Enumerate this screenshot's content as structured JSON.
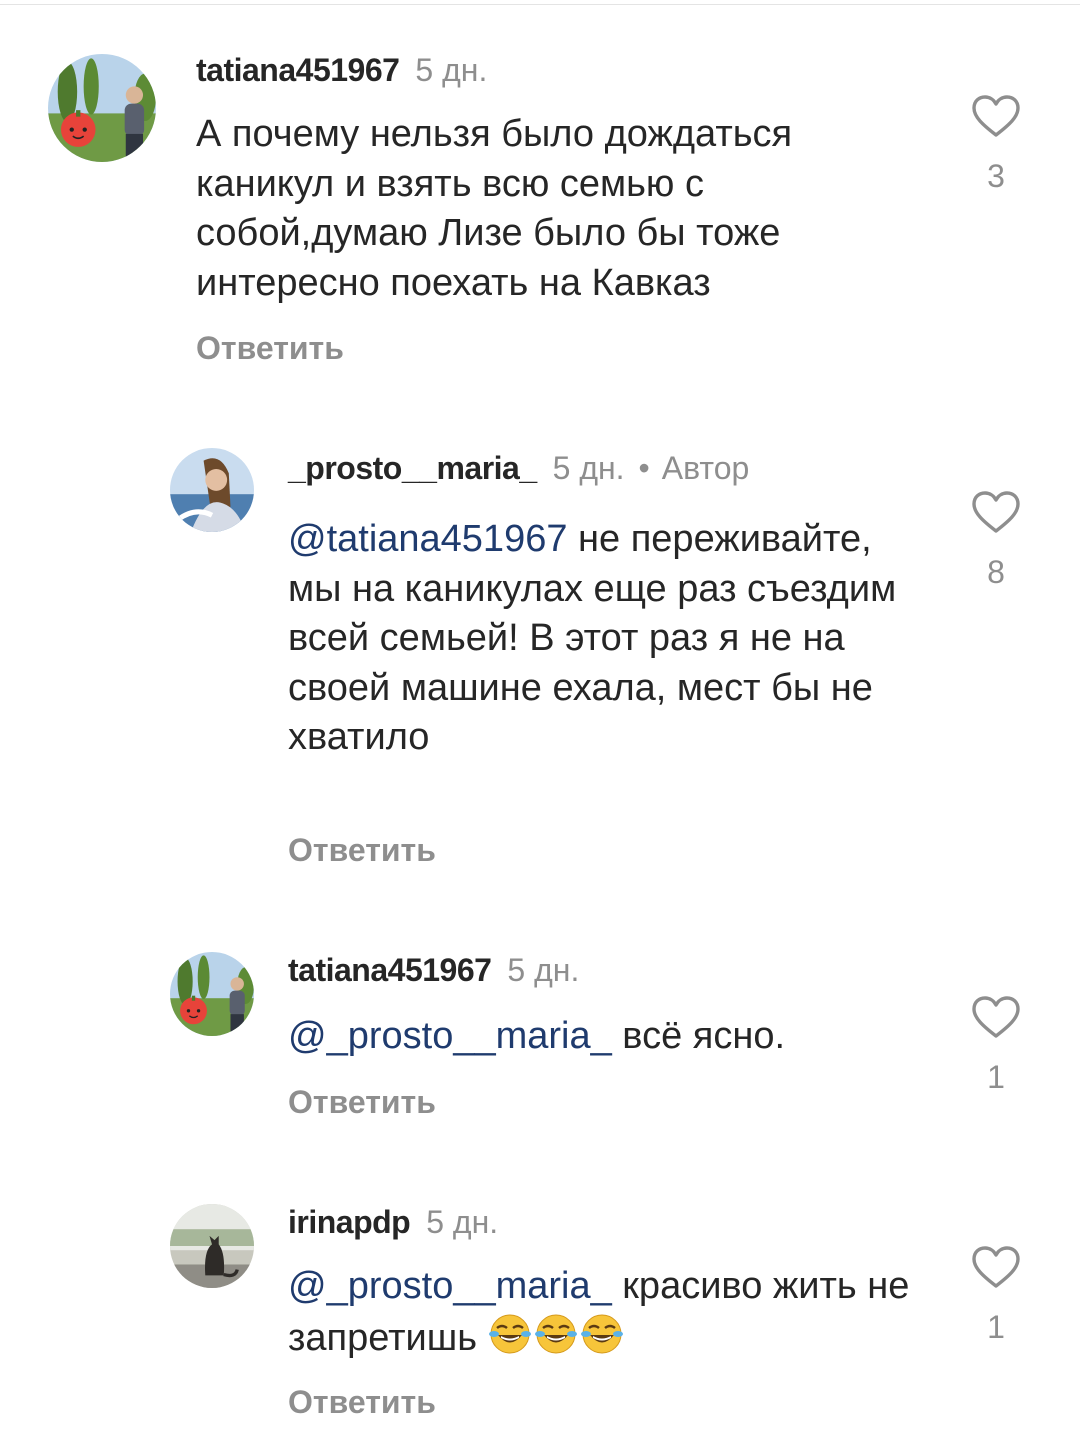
{
  "comments": [
    {
      "username": "tatiana451967",
      "time": "5 дн.",
      "text": "А почему нельзя было дождаться каникул и взять всю семью с собой,думаю Лизе было бы тоже интересно поехать на Кавказ",
      "reply_label": "Ответить",
      "likes": "3"
    },
    {
      "username": "_prosto__maria_",
      "time": "5 дн.",
      "separator": "•",
      "author_badge": "Автор",
      "mention": "@tatiana451967",
      "text": " не переживайте, мы на каникулах еще раз съездим всей семьей! В этот раз я не на своей машине ехала, мест бы не хватило",
      "reply_label": "Ответить",
      "likes": "8"
    },
    {
      "username": "tatiana451967",
      "time": "5 дн.",
      "mention": "@_prosto__maria_",
      "text": " всё ясно.",
      "reply_label": "Ответить",
      "likes": "1"
    },
    {
      "username": "irinapdp",
      "time": "5 дн.",
      "mention": "@_prosto__maria_",
      "text": " красиво жить не запретишь ",
      "emojis": [
        "face-with-tears-of-joy",
        "face-with-tears-of-joy",
        "face-with-tears-of-joy"
      ],
      "reply_label": "Ответить",
      "likes": "1"
    }
  ],
  "colors": {
    "text": "#262626",
    "secondary": "#8e8e8e",
    "mention": "#1f3b6e",
    "background": "#ffffff"
  }
}
